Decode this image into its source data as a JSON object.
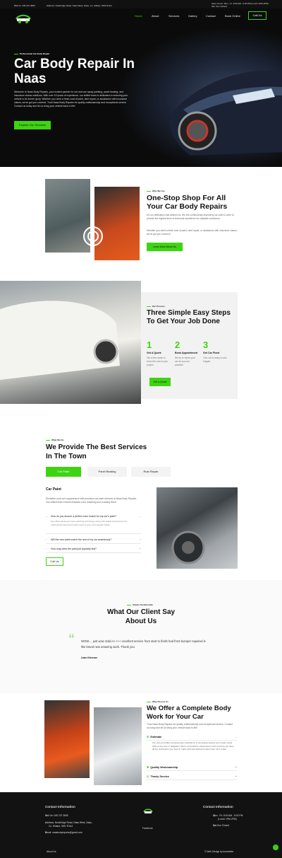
{
  "topbar": {
    "phone": "Call Us: 045 237 3805",
    "address": "Address: Newbridge Road, Naas West, Naas, Co. Kildare, W91 R1A4",
    "hours": "Open Hours: Mon - Fr: 8:00 AM - 6:00 PM (Lunch 1PM-2PM)",
    "hours_sun": "Sat- Sun Closed",
    "accent": "#3fd411"
  },
  "header": {
    "logo_text": "Naas Body Repairs",
    "nav": [
      "Home",
      "About",
      "Services",
      "Gallery",
      "Contact",
      "Book Online"
    ],
    "call_button": "Call Us"
  },
  "hero": {
    "kicker": "Professional Car Body Repair",
    "title": "Car Body Repair In Naas",
    "text": "Welcome to Naas Body Repairs, your trusted partner for car and van spray painting, panel beating, and insurance claims solutions. With over 15 years of experience, our skilled team is dedicated to restoring your vehicle to its former glory. Whether you need a fresh coat of paint, dent repair, or assistance with insurance claims, we've got you covered. Trust Naas Body Repairs for quality craftsmanship and exceptional service. Contact us today and let us bring your vehicle back to life!",
    "button": "Explore Our Services"
  },
  "about": {
    "kicker": "Who We Are",
    "title": "One-Stop Shop For All Your Car Body Repairs",
    "p1": "It's our dedication that defines us. We are continuously improving our craft in order to provide the highest level of technical excellence for valuable customers.",
    "p2": "Whether you need a fresh coat of paint, dent repair, or assistance with insurance claims, we've got you covered!",
    "button": "Learn More About Us"
  },
  "process": {
    "kicker": "Our Process",
    "title": "Three Simple Easy Steps To Get Your Job Done",
    "steps": [
      {
        "num": "1",
        "title": "Get A Quote",
        "text": "Get a free quote to know the cost of your project."
      },
      {
        "num": "2",
        "title": "Book Appointment",
        "text": "We try to repair your car as soon as possible."
      },
      {
        "num": "3",
        "title": "Get Car Fixed",
        "text": "Your car is ready to use it again."
      }
    ],
    "button": "Get a Quote"
  },
  "services": {
    "kicker": "What We Do",
    "title": "We Provide The Best Services In The Town",
    "tabs": [
      "Car Paint",
      "Panel Beating",
      "Rust Repair"
    ],
    "active_title": "Car Paint",
    "intro": "Revitalize your car's appearance with precision car paint services at Naas Body Repairs. Our skilled team ensures flawless color matching and a lasting finish.",
    "faqs": [
      {
        "q": "How do you ensure a perfect color match for my car's paint?",
        "a": "We utilize advanced color-matching technology along with skilled technicians who meticulously blend and match paint to your car's specific shade."
      },
      {
        "q": "Will the new paint match the rest of my car seamlessly?"
      },
      {
        "q": "How long does the paint job typically last?"
      }
    ],
    "button": "Call Us"
  },
  "testimonials": {
    "kicker": "Clients Testimonials",
    "title": "What Our Client Say About Us",
    "quote": "WOW.... just wow Gabi A++++ excellent service from start to finish had front bumper repaired is like brand new amazing work. Thank you",
    "author": "Liam Kiernan"
  },
  "why": {
    "kicker": "Why Choose Us",
    "title": "We Offer a Complete Body Work for Your Car",
    "text": "Trust Naas Body Repairs for quality craftsmanship and exceptional service. Contact us today and let us bring your vehicle back to life!",
    "items": [
      {
        "label": "Estimate",
        "text": "Our team provides complimentary evaluations to accurately assess your repair needs without any cost or obligation. We're committed to transparency and ensuring you have all the information you need to make informed decisions about your car's repair."
      },
      {
        "label": "Quality Workmanship"
      },
      {
        "label": "Timely Service"
      }
    ]
  },
  "footer": {
    "left_heading": "Contact Information",
    "call": "Call Us: 045 237 3805",
    "address_l1": "Address: Newbridge Road, Naas West, Naas,",
    "address_l2": "Co. Kildare, W91 R1A4",
    "email": "Email: naasbodyrepairs@gmail.com",
    "social": "Facebook",
    "right_heading": "Contact Information",
    "hours": "Mon - Fri: 8:00 AM - 6:00 PM",
    "lunch": "(Lunch 1PM-2PM)",
    "closed": "Sat-Sun Closed",
    "about_link": "About Us",
    "credit": "© Web Design by knumedia"
  }
}
